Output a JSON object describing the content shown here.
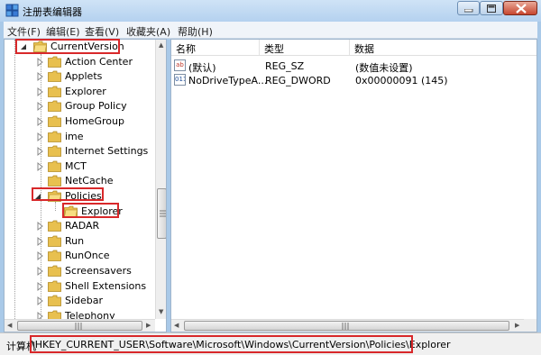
{
  "window": {
    "title": "注册表编辑器",
    "controls": [
      "minimize",
      "maximize",
      "close"
    ]
  },
  "menu": [
    {
      "label": "文件(F)"
    },
    {
      "label": "编辑(E)"
    },
    {
      "label": "查看(V)"
    },
    {
      "label": "收藏夹(A)"
    },
    {
      "label": "帮助(H)"
    }
  ],
  "tree": {
    "parent": {
      "label": "CurrentVersion",
      "expanded": true
    },
    "items": [
      {
        "label": "Action Center"
      },
      {
        "label": "Applets"
      },
      {
        "label": "Explorer"
      },
      {
        "label": "Group Policy"
      },
      {
        "label": "HomeGroup"
      },
      {
        "label": "ime"
      },
      {
        "label": "Internet Settings"
      },
      {
        "label": "MCT"
      },
      {
        "label": "NetCache"
      },
      {
        "label": "Policies",
        "expanded": true
      },
      {
        "label": "Explorer",
        "selected": true
      },
      {
        "label": "RADAR"
      },
      {
        "label": "Run"
      },
      {
        "label": "RunOnce"
      },
      {
        "label": "Screensavers"
      },
      {
        "label": "Shell Extensions"
      },
      {
        "label": "Sidebar"
      },
      {
        "label": "Telephony"
      }
    ]
  },
  "values": {
    "headers": {
      "name": "名称",
      "type": "类型",
      "data": "数据"
    },
    "rows": [
      {
        "name": "(默认)",
        "type": "REG_SZ",
        "data": "(数值未设置)",
        "icon": "string-value-icon",
        "icon_text": "ab"
      },
      {
        "name": "NoDriveTypeA...",
        "type": "REG_DWORD",
        "data": "0x00000091 (145)",
        "icon": "binary-value-icon",
        "icon_text": "011"
      }
    ]
  },
  "status": {
    "prefix": "计算机",
    "path": "\\HKEY_CURRENT_USER\\Software\\Microsoft\\Windows\\CurrentVersion\\Policies\\Explorer"
  },
  "colors": {
    "highlight_box": "#d8282a",
    "folder": "#e8c04f",
    "titlebar": "#b4d1ef"
  }
}
